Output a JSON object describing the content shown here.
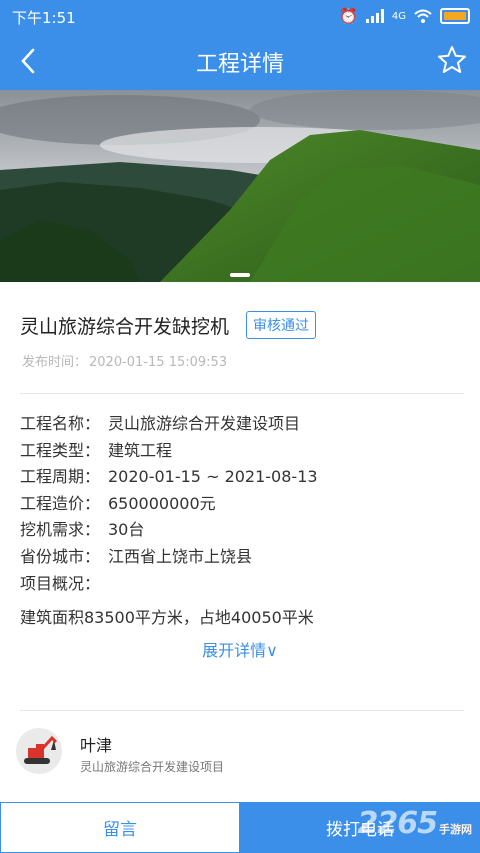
{
  "status_bar": {
    "time": "下午1:51",
    "network": "4G"
  },
  "header": {
    "title": "工程详情"
  },
  "project": {
    "title": "灵山旅游综合开发缺挖机",
    "badge": "审核通过",
    "publish_label": "发布时间：",
    "publish_time": "2020-01-15 15:09:53"
  },
  "details": [
    {
      "label": "工程名称：",
      "value": "灵山旅游综合开发建设项目"
    },
    {
      "label": "工程类型：",
      "value": "建筑工程"
    },
    {
      "label": "工程周期：",
      "value": "2020-01-15 ~ 2021-08-13"
    },
    {
      "label": "工程造价：",
      "value": "650000000元"
    },
    {
      "label": "挖机需求：",
      "value": "30台"
    },
    {
      "label": "省份城市：",
      "value": "江西省上饶市上饶县"
    },
    {
      "label": "项目概况：",
      "value": ""
    }
  ],
  "overview": "建筑面积83500平方米，占地40050平米",
  "expand_label": "展开详情∨",
  "contact": {
    "name": "叶津",
    "project": "灵山旅游综合开发建设项目"
  },
  "bottom": {
    "message_label": "留言",
    "call_label": "拨打电话"
  },
  "watermark": {
    "text": "2265",
    "site": "手游网"
  },
  "colors": {
    "primary": "#3b8fe9",
    "badge": "#3b8fe9"
  }
}
